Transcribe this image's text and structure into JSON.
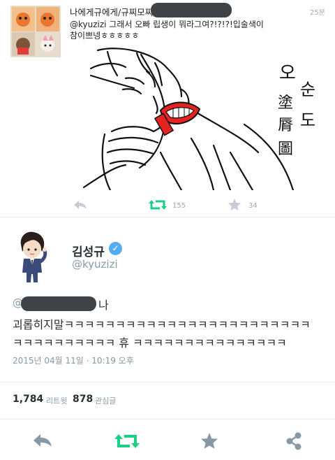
{
  "reply": {
    "name": "나에게규에게/규찌모찌",
    "time": "25분",
    "text_line1": "@kyuzizi 그래서 오빠 립생이 뭐라그여?!?!?!입술색이",
    "text_line2": "참이쁘넹ㅎㅎㅎㅎㅎ",
    "retweet_count": "155",
    "favorite_count": "34"
  },
  "media": {
    "calligraphy": [
      "오",
      "순",
      "도",
      "塗",
      "脣",
      "圖"
    ]
  },
  "tweet": {
    "author_name": "김성규",
    "author_handle": "@kyuzizi",
    "mention_at": "@",
    "mention_suffix": "나",
    "line1": "괴롭히지말ㅋㅋㅋㅋㅋㅋㅋㅋㅋㅋㅋㅋㅋㅋㅋㅋㅋㅋㅋㅋㅋㅋㅋㅋ",
    "line2": "ㅋㅋㅋㅋㅋㅋㅋㅋㅋㅋ 휴 ㅋㅋㅋㅋㅋㅋㅋㅋㅋㅋㅋㅋㅋㅋㅋ",
    "timestamp": "2015년 04월 11일 · 10:19 오후"
  },
  "stats": {
    "retweets_value": "1,784",
    "retweets_label": "리트윗",
    "favorites_value": "878",
    "favorites_label": "관심글"
  },
  "colors": {
    "retweet_green": "#19cf86",
    "action_gray": "#8899a6",
    "verified_blue": "#55acee"
  }
}
